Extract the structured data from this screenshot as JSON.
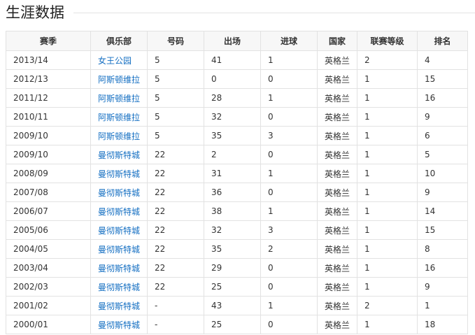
{
  "section": {
    "title": "生涯数据"
  },
  "table": {
    "headers": [
      "赛季",
      "俱乐部",
      "号码",
      "出场",
      "进球",
      "国家",
      "联赛等级",
      "排名"
    ],
    "rows": [
      [
        "2013/14",
        "女王公园",
        "5",
        "41",
        "1",
        "英格兰",
        "2",
        "4"
      ],
      [
        "2012/13",
        "阿斯顿维拉",
        "5",
        "0",
        "0",
        "英格兰",
        "1",
        "15"
      ],
      [
        "2011/12",
        "阿斯顿维拉",
        "5",
        "28",
        "1",
        "英格兰",
        "1",
        "16"
      ],
      [
        "2010/11",
        "阿斯顿维拉",
        "5",
        "32",
        "0",
        "英格兰",
        "1",
        "9"
      ],
      [
        "2009/10",
        "阿斯顿维拉",
        "5",
        "35",
        "3",
        "英格兰",
        "1",
        "6"
      ],
      [
        "2009/10",
        "曼彻斯特城",
        "22",
        "2",
        "0",
        "英格兰",
        "1",
        "5"
      ],
      [
        "2008/09",
        "曼彻斯特城",
        "22",
        "31",
        "1",
        "英格兰",
        "1",
        "10"
      ],
      [
        "2007/08",
        "曼彻斯特城",
        "22",
        "36",
        "0",
        "英格兰",
        "1",
        "9"
      ],
      [
        "2006/07",
        "曼彻斯特城",
        "22",
        "38",
        "1",
        "英格兰",
        "1",
        "14"
      ],
      [
        "2005/06",
        "曼彻斯特城",
        "22",
        "32",
        "3",
        "英格兰",
        "1",
        "15"
      ],
      [
        "2004/05",
        "曼彻斯特城",
        "22",
        "35",
        "2",
        "英格兰",
        "1",
        "8"
      ],
      [
        "2003/04",
        "曼彻斯特城",
        "22",
        "29",
        "0",
        "英格兰",
        "1",
        "16"
      ],
      [
        "2002/03",
        "曼彻斯特城",
        "22",
        "25",
        "0",
        "英格兰",
        "1",
        "9"
      ],
      [
        "2001/02",
        "曼彻斯特城",
        "-",
        "43",
        "1",
        "英格兰",
        "2",
        "1"
      ],
      [
        "2000/01",
        "曼彻斯特城",
        "-",
        "25",
        "0",
        "英格兰",
        "1",
        "18"
      ]
    ]
  },
  "colors": {
    "link": "#136ec2",
    "border": "#e2e2e2",
    "header_bg": "#f7f7f7"
  }
}
